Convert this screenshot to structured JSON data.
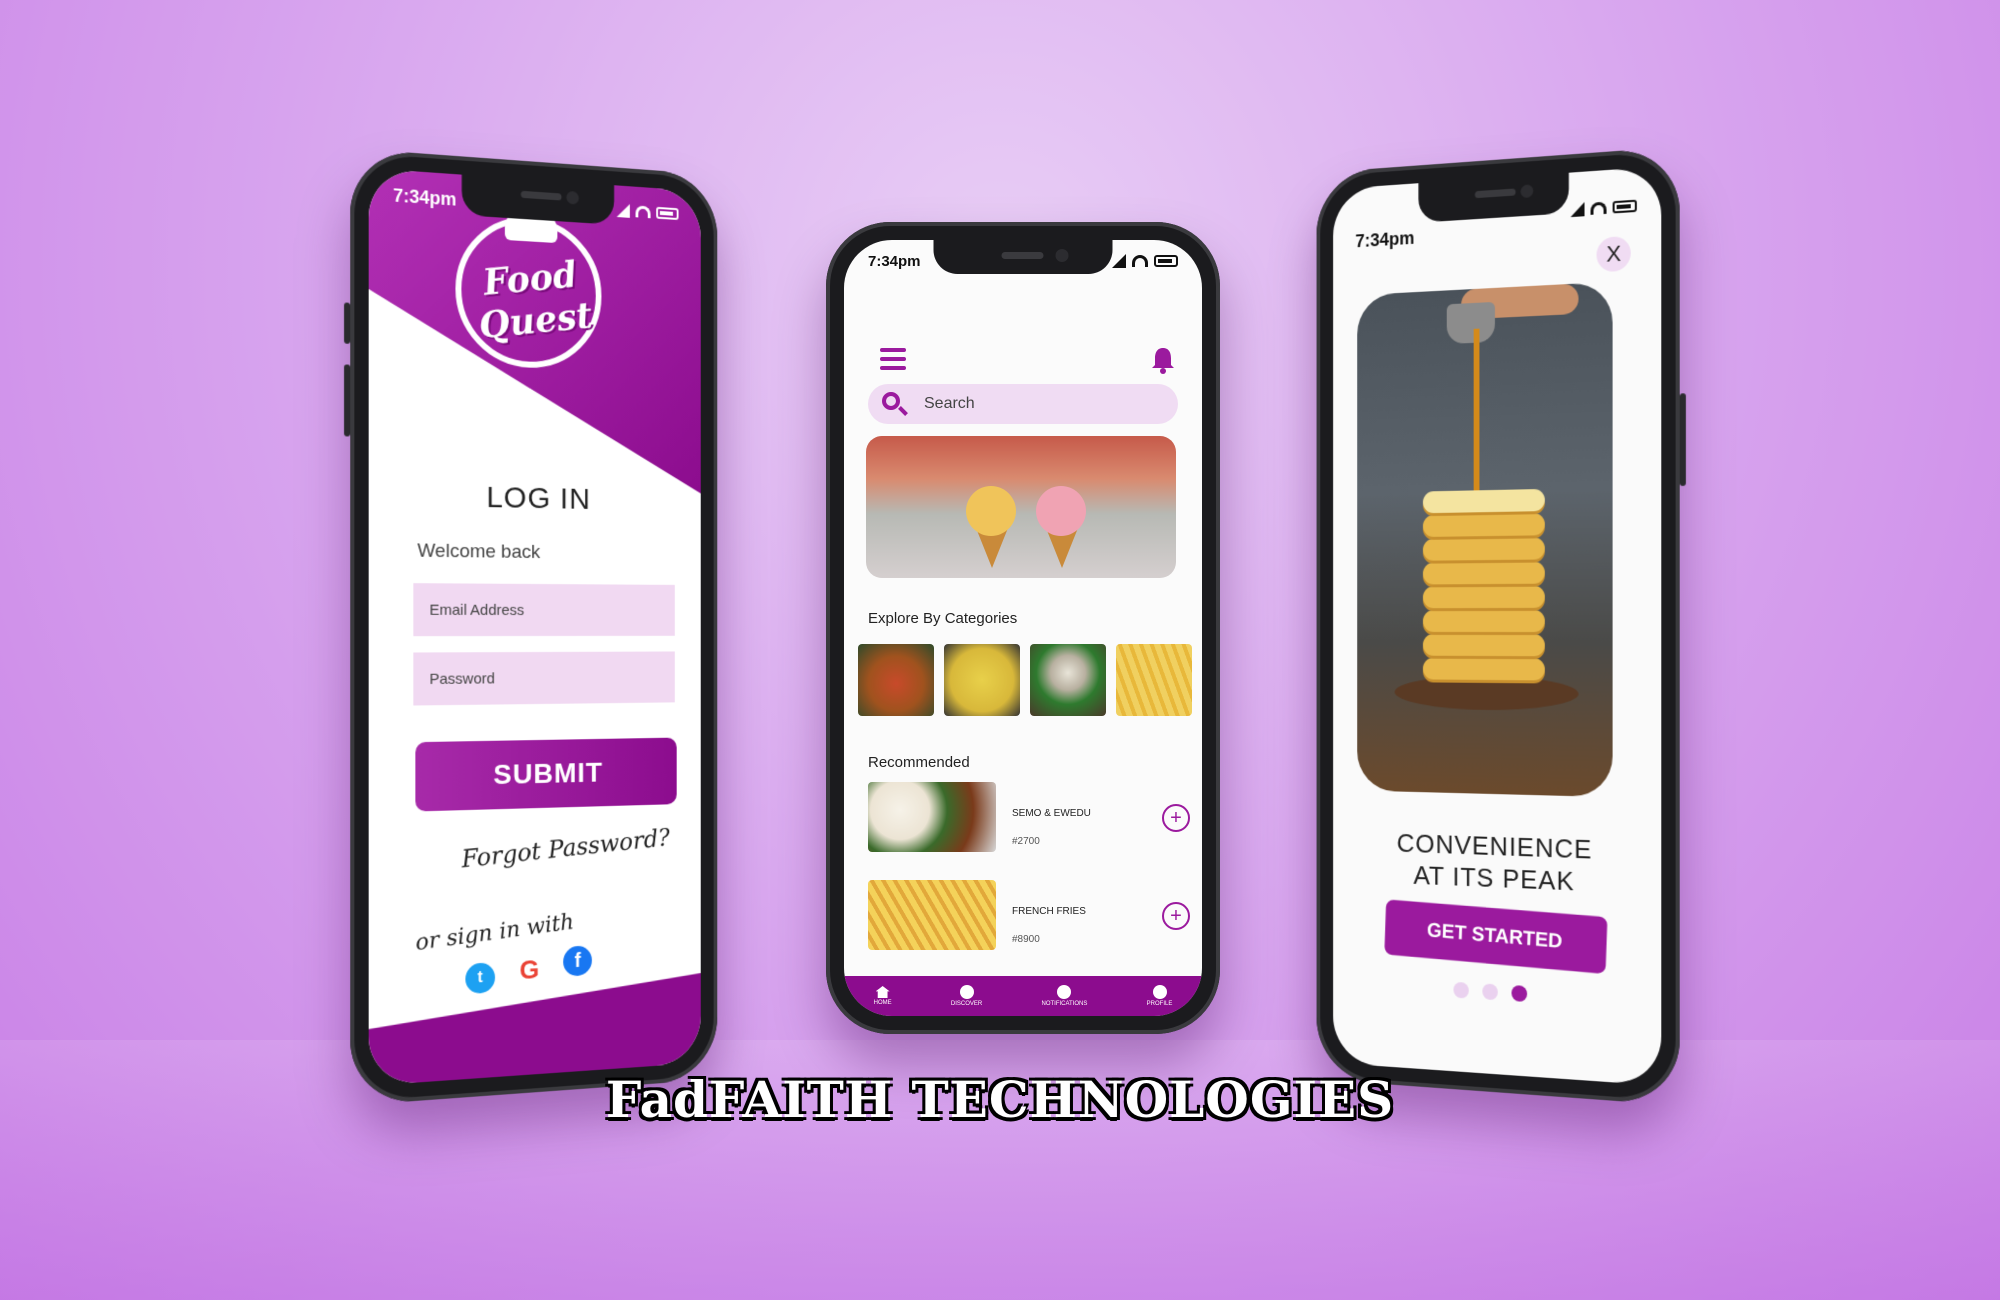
{
  "status": {
    "time": "7:34pm"
  },
  "login": {
    "logo_text": "Food Quest",
    "title": "LOG IN",
    "welcome": "Welcome back",
    "email_placeholder": "Email Address",
    "password_placeholder": "Password",
    "submit": "SUBMIT",
    "forgot": "Forgot Password?",
    "or_sign": "or sign in with",
    "social": [
      "twitter-icon",
      "google-icon",
      "facebook-icon"
    ]
  },
  "home": {
    "search_placeholder": "Search",
    "categories_title": "Explore By Categories",
    "recommended_title": "Recommended",
    "recommended": [
      {
        "name": "SEMO & EWEDU",
        "price": "#2700"
      },
      {
        "name": "FRENCH FRIES",
        "price": "#8900"
      }
    ],
    "nav": [
      "HOME",
      "DISCOVER",
      "NOTIFICATIONS",
      "PROFILE"
    ]
  },
  "onboarding": {
    "close": "X",
    "headline_line1": "CONVENIENCE",
    "headline_line2": "AT ITS PEAK",
    "cta": "GET STARTED",
    "page_index": 3,
    "page_count": 3
  },
  "brand": "FadFAITH TECHNOLOGIES",
  "colors": {
    "accent": "#9b1a9e",
    "accent_dark": "#8c0c8e",
    "field_bg": "#f1d9f2"
  }
}
